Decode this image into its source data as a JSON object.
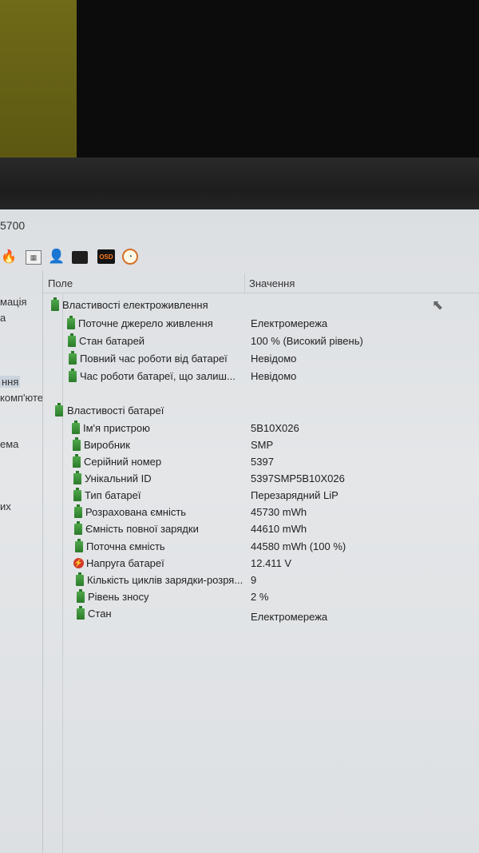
{
  "window": {
    "title_fragment": "5700"
  },
  "left_nav": {
    "fragments": [
      "мація",
      "а",
      "ння",
      "комп'ютеі",
      "ема",
      "их"
    ]
  },
  "table": {
    "header_field": "Поле",
    "header_value": "Значення",
    "sections": [
      {
        "label": "Властивості електроживлення",
        "rows": [
          {
            "label": "Поточне джерело живлення",
            "value": "Електромережа"
          },
          {
            "label": "Стан батарей",
            "value": "100 % (Високий рівень)"
          },
          {
            "label": "Повний час роботи від батареї",
            "value": "Невідомо"
          },
          {
            "label": "Час роботи батареї, що залиш...",
            "value": "Невідомо"
          }
        ]
      },
      {
        "label": "Властивості батареї",
        "rows": [
          {
            "label": "Ім'я пристрою",
            "value": "5B10X026"
          },
          {
            "label": "Виробник",
            "value": "SMP"
          },
          {
            "label": "Серійний номер",
            "value": "5397"
          },
          {
            "label": "Унікальний ID",
            "value": "5397SMP5B10X026"
          },
          {
            "label": "Тип батареї",
            "value": "Перезарядний LiP"
          },
          {
            "label": "Розрахована ємність",
            "value": "45730 mWh"
          },
          {
            "label": "Ємність повної зарядки",
            "value": "44610 mWh"
          },
          {
            "label": "Поточна ємність",
            "value": "44580 mWh  (100 %)"
          },
          {
            "label": "Напруга батареї",
            "value": "12.411 V"
          },
          {
            "label": "Кількість циклів зарядки-розря...",
            "value": "9"
          },
          {
            "label": "Рівень зносу",
            "value": "2 %"
          },
          {
            "label": "Стан",
            "value": "Електромережа"
          }
        ]
      }
    ]
  },
  "toolbar": {
    "osd_label": "OSD",
    "icons": [
      "flame-icon",
      "calendar-icon",
      "user-icon",
      "monitor-icon",
      "osd-icon",
      "gauge-icon"
    ]
  }
}
